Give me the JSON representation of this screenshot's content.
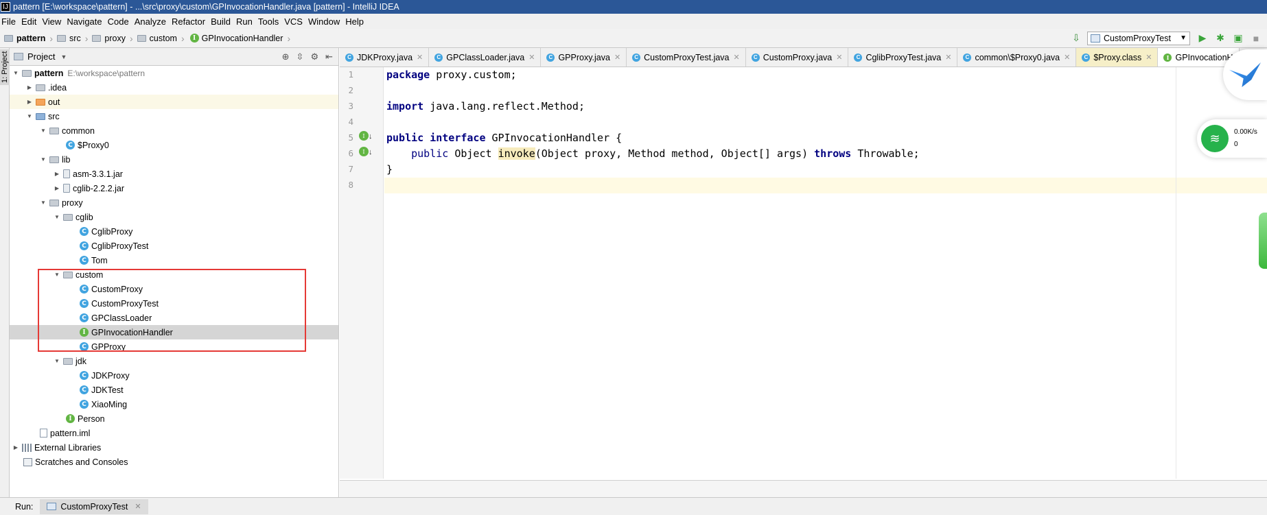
{
  "window": {
    "title": "pattern [E:\\workspace\\pattern] - ...\\src\\proxy\\custom\\GPInvocationHandler.java [pattern] - IntelliJ IDEA"
  },
  "menu": [
    "File",
    "Edit",
    "View",
    "Navigate",
    "Code",
    "Analyze",
    "Refactor",
    "Build",
    "Run",
    "Tools",
    "VCS",
    "Window",
    "Help"
  ],
  "breadcrumb": [
    "pattern",
    "src",
    "proxy",
    "custom",
    "GPInvocationHandler"
  ],
  "run_config": {
    "label": "CustomProxyTest"
  },
  "project_panel": {
    "title": "Project",
    "tab_label": "1: Project",
    "tree": [
      {
        "label": "pattern",
        "hint": "E:\\workspace\\pattern"
      },
      {
        "label": ".idea"
      },
      {
        "label": "out"
      },
      {
        "label": "src"
      },
      {
        "label": "common"
      },
      {
        "label": "$Proxy0"
      },
      {
        "label": "lib"
      },
      {
        "label": "asm-3.3.1.jar"
      },
      {
        "label": "cglib-2.2.2.jar"
      },
      {
        "label": "proxy"
      },
      {
        "label": "cglib"
      },
      {
        "label": "CglibProxy"
      },
      {
        "label": "CglibProxyTest"
      },
      {
        "label": "Tom"
      },
      {
        "label": "custom"
      },
      {
        "label": "CustomProxy"
      },
      {
        "label": "CustomProxyTest"
      },
      {
        "label": "GPClassLoader"
      },
      {
        "label": "GPInvocationHandler"
      },
      {
        "label": "GPProxy"
      },
      {
        "label": "jdk"
      },
      {
        "label": "JDKProxy"
      },
      {
        "label": "JDKTest"
      },
      {
        "label": "XiaoMing"
      },
      {
        "label": "Person"
      },
      {
        "label": "pattern.iml"
      },
      {
        "label": "External Libraries"
      },
      {
        "label": "Scratches and Consoles"
      }
    ]
  },
  "editor": {
    "tabs": [
      {
        "label": "JDKProxy.java",
        "icon": "C"
      },
      {
        "label": "GPClassLoader.java",
        "icon": "C"
      },
      {
        "label": "GPProxy.java",
        "icon": "C"
      },
      {
        "label": "CustomProxyTest.java",
        "icon": "C"
      },
      {
        "label": "CustomProxy.java",
        "icon": "C"
      },
      {
        "label": "CglibProxyTest.java",
        "icon": "C"
      },
      {
        "label": "common\\$Proxy0.java",
        "icon": "C"
      },
      {
        "label": "$Proxy.class",
        "icon": "C"
      },
      {
        "label": "GPInvocationH",
        "icon": "I"
      }
    ],
    "line_numbers": [
      "1",
      "2",
      "3",
      "4",
      "5",
      "6",
      "7",
      "8"
    ],
    "code": {
      "l1_kw": "package",
      "l1_rest": " proxy.custom;",
      "l3_kw": "import",
      "l3_rest": " java.lang.reflect.Method;",
      "l5_kw1": "public",
      "l5_kw2": "interface",
      "l5_rest": " GPInvocationHandler {",
      "l6_kw1": "public",
      "l6_pre": " Object ",
      "l6_method": "invoke",
      "l6_args": "(Object proxy, Method method, Object[] args) ",
      "l6_kw2": "throws",
      "l6_rest": " Throwable;",
      "l7": "}"
    }
  },
  "run_bar": {
    "label": "Run:",
    "tab": "CustomProxyTest"
  },
  "overlay": {
    "speed": "0.00K/s",
    "count": "0"
  },
  "colors": {
    "titlebar": "#2b5797",
    "keyword": "#000080",
    "annotation_box": "#e53935",
    "class_icon": "#41a4e0",
    "interface_icon": "#62b543"
  }
}
